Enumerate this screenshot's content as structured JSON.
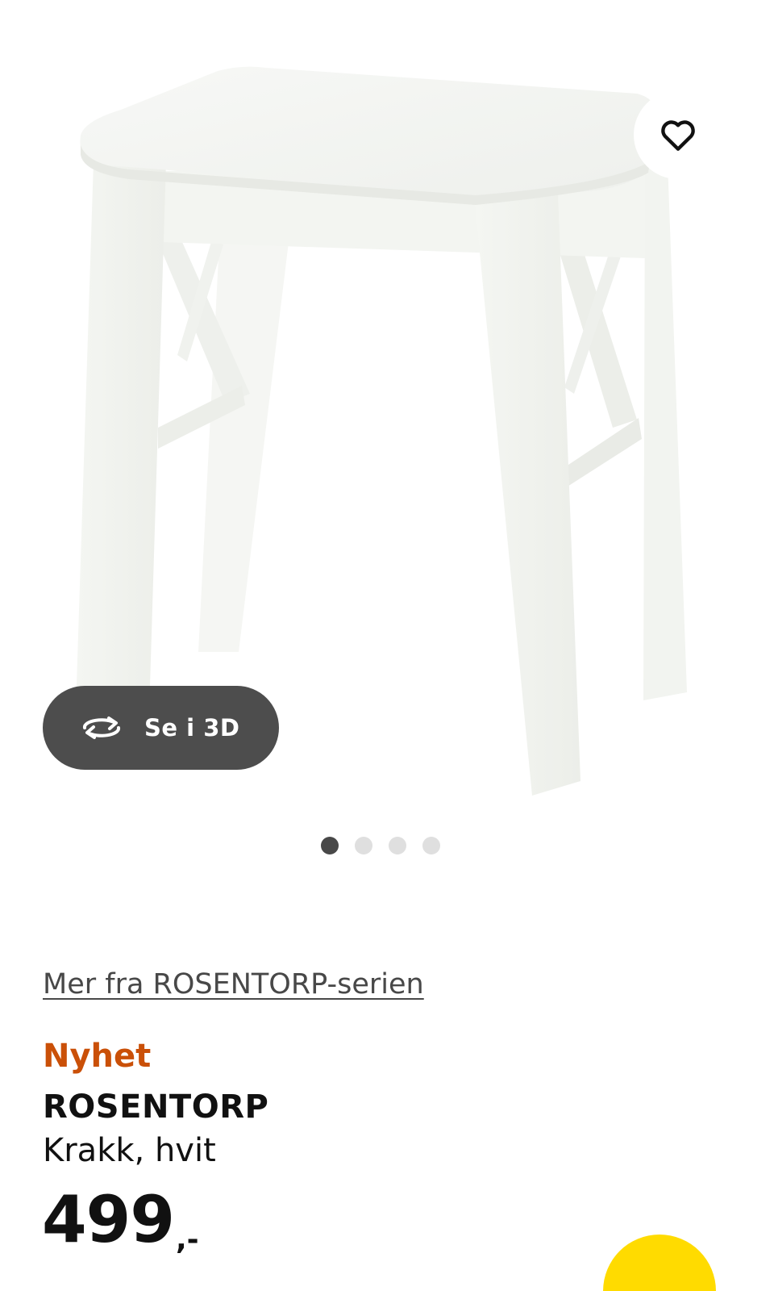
{
  "product": {
    "series_link": "Mer fra ROSENTORP-serien",
    "badge": "Nyhet",
    "name": "ROSENTORP",
    "description": "Krakk, hvit",
    "price_integer": "499",
    "price_suffix": ",-"
  },
  "gallery": {
    "view_3d_label": "Se i 3D",
    "image_count": 4,
    "active_index": 0,
    "image_subject": "stool"
  },
  "icons": {
    "favorite": "heart-icon",
    "rotate_3d": "rotate-3d-icon"
  },
  "colors": {
    "badge_new": "#ca5008",
    "view_3d_button": "#4d4d4d",
    "dot_active": "#484848",
    "dot_inactive": "#dfdfdf",
    "cart_button": "#ffdb00"
  }
}
